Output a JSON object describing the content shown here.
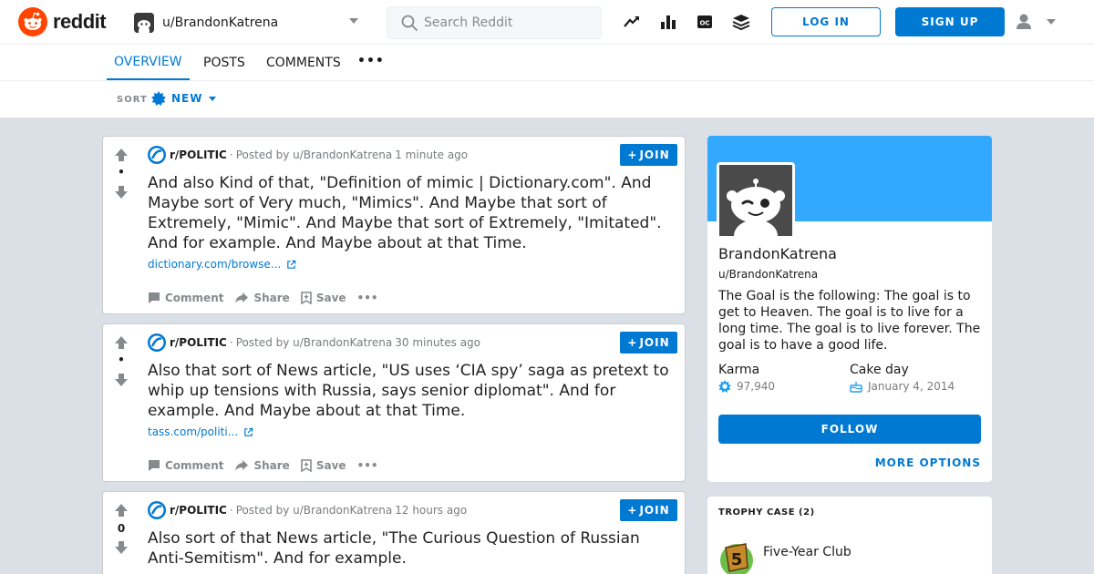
{
  "header": {
    "logo_text": "reddit",
    "current_user": "u/BrandonKatrena",
    "search_placeholder": "Search Reddit",
    "login_label": "LOG IN",
    "signup_label": "SIGN UP"
  },
  "tabs": [
    {
      "label": "OVERVIEW",
      "active": true
    },
    {
      "label": "POSTS",
      "active": false
    },
    {
      "label": "COMMENTS",
      "active": false
    }
  ],
  "tab_more": "•••",
  "sort": {
    "label": "SORT",
    "value": "NEW"
  },
  "posts": [
    {
      "subreddit": "r/POLITIC",
      "posted_by": "Posted by u/BrandonKatrena",
      "time": "1 minute ago",
      "votes": "•",
      "join_label": "JOIN",
      "title": "And also Kind of that, \"Definition of mimic | Dictionary.com\". And Maybe sort of Very much, \"Mimics\". And Maybe that sort of Extremely, \"Mimic\". And Maybe that sort of Extremely, \"Imitated\". And for example. And Maybe about at that Time.",
      "link": "dictionary.com/browse...",
      "actions": {
        "comment": "Comment",
        "share": "Share",
        "save": "Save",
        "more": "•••"
      }
    },
    {
      "subreddit": "r/POLITIC",
      "posted_by": "Posted by u/BrandonKatrena",
      "time": "30 minutes ago",
      "votes": "•",
      "join_label": "JOIN",
      "title": "Also that sort of News article, \"US uses ‘CIA spy’ saga as pretext to whip up tensions with Russia, says senior diplomat\". And for example. And Maybe about at that Time.",
      "link": "tass.com/politi...",
      "actions": {
        "comment": "Comment",
        "share": "Share",
        "save": "Save",
        "more": "•••"
      }
    },
    {
      "subreddit": "r/POLITIC",
      "posted_by": "Posted by u/BrandonKatrena",
      "time": "12 hours ago",
      "votes": "0",
      "join_label": "JOIN",
      "title": "Also sort of that News article, \"The Curious Question of Russian Anti-Semitism\". And for example."
    }
  ],
  "profile": {
    "display_name": "BrandonKatrena",
    "username": "u/BrandonKatrena",
    "bio": "The Goal is the following: The goal is to get to Heaven. The goal is to live for a long time. The goal is to live forever. The goal is to have a good life.",
    "karma_label": "Karma",
    "karma_value": "97,940",
    "cakeday_label": "Cake day",
    "cakeday_value": "January 4, 2014",
    "follow_label": "FOLLOW",
    "more_options_label": "MORE OPTIONS",
    "banner_color": "#33a8ff"
  },
  "trophy_case": {
    "title": "TROPHY CASE (2)",
    "items": [
      {
        "name": "Five-Year Club"
      }
    ]
  },
  "colors": {
    "accent": "#0079d3",
    "brand": "#ff4500"
  }
}
